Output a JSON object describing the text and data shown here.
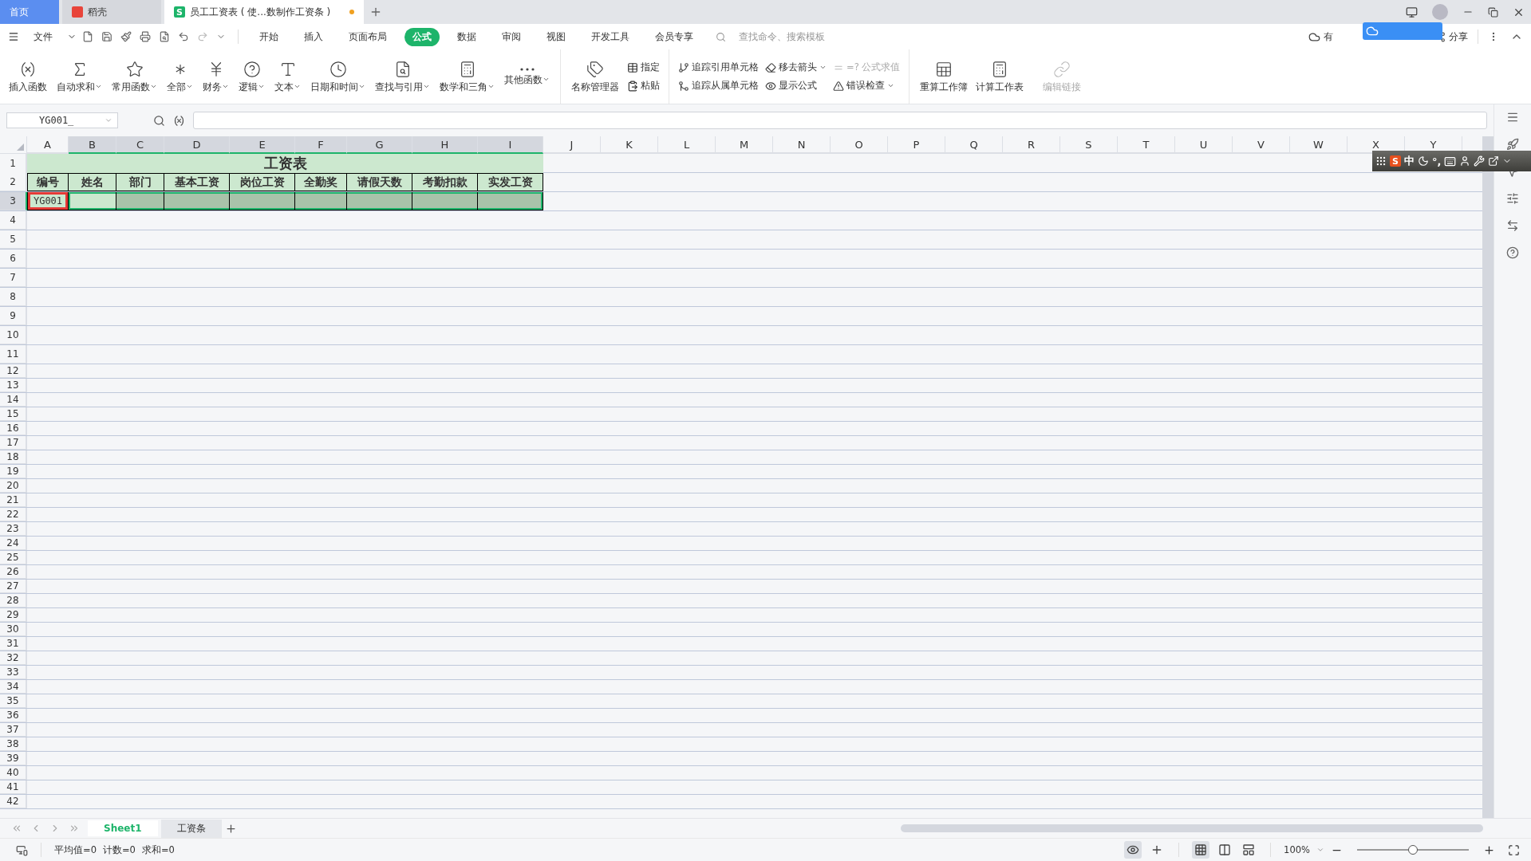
{
  "tabs": [
    {
      "label": "首页",
      "selected": false,
      "kind": "home"
    },
    {
      "label": "稻壳",
      "selected": false,
      "kind": "docer"
    },
    {
      "label": "员工工资表 ( 使...数制作工资条 )",
      "selected": true,
      "kind": "sheet",
      "icon_letter": "S",
      "unsaved": true
    }
  ],
  "menu": {
    "file": "文件",
    "tabs": [
      {
        "label": "开始",
        "selected": false
      },
      {
        "label": "插入",
        "selected": false
      },
      {
        "label": "页面布局",
        "selected": false
      },
      {
        "label": "公式",
        "selected": true
      },
      {
        "label": "数据",
        "selected": false
      },
      {
        "label": "审阅",
        "selected": false
      },
      {
        "label": "视图",
        "selected": false
      },
      {
        "label": "开发工具",
        "selected": false
      },
      {
        "label": "会员专享",
        "selected": false
      }
    ],
    "search": {
      "placeholder": "查找命令、搜索模板"
    },
    "cloud_status": "有",
    "share": "分享"
  },
  "ribbon": {
    "functions": [
      {
        "label": "插入函数",
        "dropdown": false
      },
      {
        "label": "自动求和",
        "dropdown": true
      },
      {
        "label": "常用函数",
        "dropdown": true
      },
      {
        "label": "全部",
        "dropdown": true
      },
      {
        "label": "财务",
        "dropdown": true
      },
      {
        "label": "逻辑",
        "dropdown": true
      },
      {
        "label": "文本",
        "dropdown": true
      },
      {
        "label": "日期和时间",
        "dropdown": true
      },
      {
        "label": "查找与引用",
        "dropdown": true
      },
      {
        "label": "数学和三角",
        "dropdown": true
      },
      {
        "label": "其他函数",
        "dropdown": true
      }
    ],
    "names": {
      "manager": "名称管理器",
      "items": [
        "指定",
        "粘贴"
      ]
    },
    "audit": [
      {
        "label": "追踪引用单元格",
        "dropdown": false,
        "disabled": false
      },
      {
        "label": "追踪从属单元格",
        "dropdown": false,
        "disabled": false
      },
      {
        "label": "移去箭头",
        "dropdown": true,
        "disabled": false
      },
      {
        "label": "显示公式",
        "dropdown": false,
        "disabled": false
      },
      {
        "label": "=? 公式求值",
        "dropdown": false,
        "disabled": true
      },
      {
        "label": "错误检查",
        "dropdown": true,
        "disabled": false
      }
    ],
    "calc": [
      {
        "label": "重算工作簿",
        "disabled": false
      },
      {
        "label": "计算工作表",
        "disabled": false
      },
      {
        "label": "编辑链接",
        "disabled": true
      }
    ]
  },
  "formula_bar": {
    "name_box": "YG001_"
  },
  "columns": [
    {
      "label": "A",
      "selected": false
    },
    {
      "label": "B",
      "selected": true
    },
    {
      "label": "C",
      "selected": true
    },
    {
      "label": "D",
      "selected": true
    },
    {
      "label": "E",
      "selected": true
    },
    {
      "label": "F",
      "selected": true
    },
    {
      "label": "G",
      "selected": true
    },
    {
      "label": "H",
      "selected": true
    },
    {
      "label": "I",
      "selected": true
    },
    {
      "label": "J",
      "selected": false
    },
    {
      "label": "K",
      "selected": false
    },
    {
      "label": "L",
      "selected": false
    },
    {
      "label": "M",
      "selected": false
    },
    {
      "label": "N",
      "selected": false
    },
    {
      "label": "O",
      "selected": false
    },
    {
      "label": "P",
      "selected": false
    },
    {
      "label": "Q",
      "selected": false
    },
    {
      "label": "R",
      "selected": false
    },
    {
      "label": "S",
      "selected": false
    },
    {
      "label": "T",
      "selected": false
    },
    {
      "label": "U",
      "selected": false
    },
    {
      "label": "V",
      "selected": false
    },
    {
      "label": "W",
      "selected": false
    },
    {
      "label": "X",
      "selected": false
    },
    {
      "label": "Y",
      "selected": false
    }
  ],
  "rows": [
    {
      "label": "1",
      "selected": false
    },
    {
      "label": "2",
      "selected": false
    },
    {
      "label": "3",
      "selected": true
    },
    {
      "label": "4",
      "selected": false
    },
    {
      "label": "5",
      "selected": false
    },
    {
      "label": "6",
      "selected": false
    },
    {
      "label": "7",
      "selected": false
    },
    {
      "label": "8",
      "selected": false
    },
    {
      "label": "9",
      "selected": false
    },
    {
      "label": "10",
      "selected": false
    },
    {
      "label": "11",
      "selected": false
    },
    {
      "label": "12",
      "selected": false
    },
    {
      "label": "13",
      "selected": false
    },
    {
      "label": "14",
      "selected": false
    },
    {
      "label": "15",
      "selected": false
    },
    {
      "label": "16",
      "selected": false
    },
    {
      "label": "17",
      "selected": false
    },
    {
      "label": "18",
      "selected": false
    },
    {
      "label": "19",
      "selected": false
    },
    {
      "label": "20",
      "selected": false
    },
    {
      "label": "21",
      "selected": false
    },
    {
      "label": "22",
      "selected": false
    },
    {
      "label": "23",
      "selected": false
    },
    {
      "label": "24",
      "selected": false
    },
    {
      "label": "25",
      "selected": false
    },
    {
      "label": "26",
      "selected": false
    },
    {
      "label": "27",
      "selected": false
    },
    {
      "label": "28",
      "selected": false
    },
    {
      "label": "29",
      "selected": false
    },
    {
      "label": "30",
      "selected": false
    },
    {
      "label": "31",
      "selected": false
    },
    {
      "label": "32",
      "selected": false
    },
    {
      "label": "33",
      "selected": false
    },
    {
      "label": "34",
      "selected": false
    },
    {
      "label": "35",
      "selected": false
    },
    {
      "label": "36",
      "selected": false
    },
    {
      "label": "37",
      "selected": false
    },
    {
      "label": "38",
      "selected": false
    },
    {
      "label": "39",
      "selected": false
    },
    {
      "label": "40",
      "selected": false
    },
    {
      "label": "41",
      "selected": false
    },
    {
      "label": "42",
      "selected": false
    }
  ],
  "table": {
    "title": "工资表",
    "headers": [
      "编号",
      "姓名",
      "部门",
      "基本工资",
      "岗位工资",
      "全勤奖",
      "请假天数",
      "考勤扣款",
      "实发工资"
    ],
    "rows": [
      {
        "cells": [
          {
            "text": "YG001",
            "selected": false,
            "active": false,
            "marked": true
          },
          {
            "selected": true,
            "active": true,
            "marked": false
          },
          {
            "selected": true,
            "active": false,
            "marked": false
          },
          {
            "selected": true,
            "active": false,
            "marked": false
          },
          {
            "selected": true,
            "active": false,
            "marked": false
          },
          {
            "selected": true,
            "active": false,
            "marked": false
          },
          {
            "selected": true,
            "active": false,
            "marked": false
          },
          {
            "selected": true,
            "active": false,
            "marked": false
          },
          {
            "selected": true,
            "active": false,
            "marked": false
          }
        ]
      }
    ]
  },
  "sheet_tabs": [
    {
      "label": "Sheet1",
      "selected": true
    },
    {
      "label": "工资条",
      "selected": false
    }
  ],
  "status": {
    "stats": [
      "平均值=0",
      "计数=0",
      "求和=0"
    ],
    "zoom": "100%",
    "level": 0.5
  },
  "ime": {
    "logo": "S",
    "mode": "中",
    "punct": "°,"
  }
}
